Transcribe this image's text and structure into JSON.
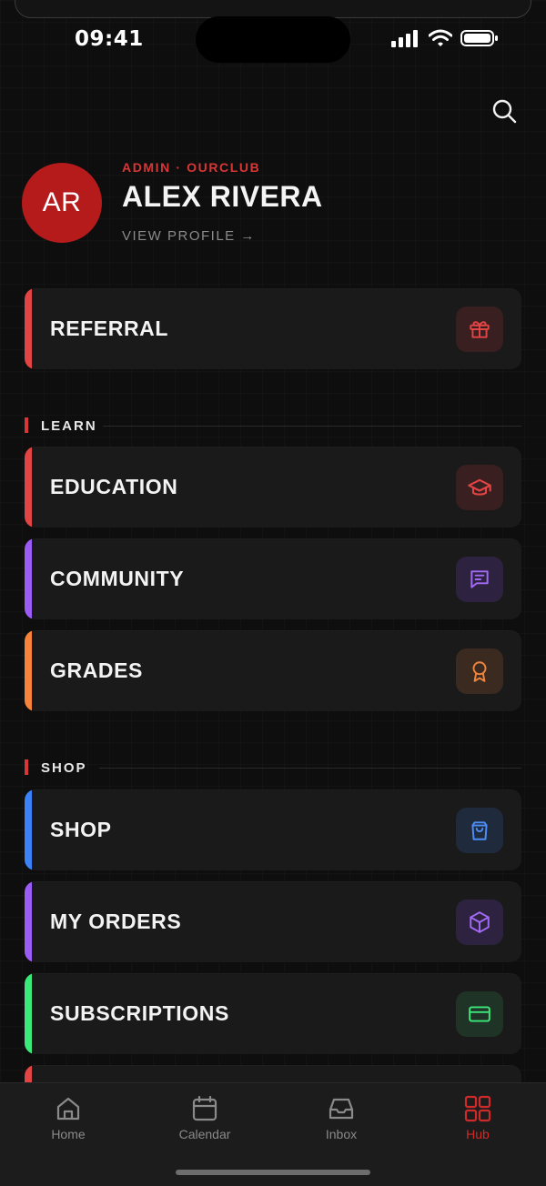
{
  "status_bar": {
    "time": "09:41"
  },
  "profile": {
    "initials": "AR",
    "role": "ADMIN · OURCLUB",
    "name": "ALEX RIVERA",
    "view_profile": "VIEW PROFILE →"
  },
  "referral": {
    "label": "REFERRAL",
    "accent": "#e04444",
    "icon": "gift-icon",
    "icon_color": "#e04444",
    "icon_bg": "#3a1f21"
  },
  "sections": {
    "learn": {
      "title": "LEARN",
      "items": [
        {
          "label": "EDUCATION",
          "accent": "#e04444",
          "icon": "graduation-cap-icon",
          "icon_color": "#e04444",
          "icon_bg": "#3a1f21"
        },
        {
          "label": "COMMUNITY",
          "accent": "#9b5cf6",
          "icon": "chat-icon",
          "icon_color": "#a36bf5",
          "icon_bg": "#2d2340"
        },
        {
          "label": "GRADES",
          "accent": "#f5843a",
          "icon": "award-icon",
          "icon_color": "#f0853f",
          "icon_bg": "#3a2a1f"
        }
      ]
    },
    "shop": {
      "title": "SHOP",
      "items": [
        {
          "label": "SHOP",
          "accent": "#3b82f6",
          "icon": "shopping-bag-icon",
          "icon_color": "#4c8df7",
          "icon_bg": "#1f2a3d"
        },
        {
          "label": "MY ORDERS",
          "accent": "#9b5cf6",
          "icon": "package-icon",
          "icon_color": "#a36bf5",
          "icon_bg": "#2d2340"
        },
        {
          "label": "SUBSCRIPTIONS",
          "accent": "#3be87a",
          "icon": "credit-card-icon",
          "icon_color": "#3be87a",
          "icon_bg": "#1f3326"
        }
      ]
    }
  },
  "tabbar": {
    "home": "Home",
    "calendar": "Calendar",
    "inbox": "Inbox",
    "hub": "Hub",
    "active_color": "#cf2a2a"
  }
}
